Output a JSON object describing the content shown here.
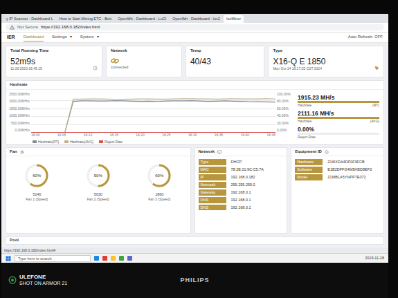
{
  "photo": {
    "watermark_brand": "ULEFONE",
    "watermark_caption": "SHOT ON ARMOR 21",
    "monitor_brand": "PHILIPS"
  },
  "browser": {
    "tabs": [
      {
        "label": "y IP Scanner - Dashboard L",
        "selected": false
      },
      {
        "label": "How to Start Mining ETC - Bett",
        "selected": false
      },
      {
        "label": "OpenWrt - Dashboard - LuCI",
        "selected": false
      },
      {
        "label": "OpenWrt - Dashboard - lux2",
        "selected": false
      },
      {
        "label": "IceMiner",
        "selected": true
      }
    ],
    "security": "Not Secure",
    "url": "https://192.168.0.182/index.html",
    "status_url": "https://192.168.0.182/index.html#"
  },
  "nav": {
    "logo": "IER",
    "items": [
      {
        "label": "Dashboard",
        "selected": true
      },
      {
        "label": "Settings",
        "caret": "▾",
        "selected": false
      },
      {
        "label": "System",
        "caret": "▾",
        "selected": false
      }
    ],
    "auto_refresh": "Auto Refresh: OFF"
  },
  "cards": [
    {
      "title": "Total Running Time",
      "value": "52m9s",
      "sub": "11-28 2023 16:45:15",
      "kind": "clock"
    },
    {
      "title": "Network",
      "value": "connected",
      "kind": "link"
    },
    {
      "title": "Temp",
      "value": "40/43",
      "kind": "plain"
    },
    {
      "title": "Type",
      "value": "X16-Q E 1850",
      "sub": "Mon Oct 14 16:17:25 CST 2024",
      "kind": "tag"
    }
  ],
  "hashrate": {
    "title": "Hashrate",
    "y_max": 2500,
    "y2_max": 100,
    "y_ticks": [
      "2500.00MH/s",
      "2000.00MH/s",
      "1500.00MH/s",
      "1000.00MH/s",
      "500.00MH/s",
      "0.00MH/s"
    ],
    "y2_ticks": [
      "100.00%",
      "80.00%",
      "60.00%",
      "40.00%",
      "20.00%",
      "0.00%"
    ],
    "x_ticks": [
      "16:00",
      "16:05",
      "16:10",
      "16:15",
      "16:20",
      "16:25",
      "16:30",
      "16:35",
      "16:40",
      "16:45"
    ],
    "series": [
      {
        "name": "Hashrate(RT)",
        "axis": "left",
        "color": "#7f8b97",
        "values": [
          0,
          0,
          0,
          0,
          0,
          1960,
          1985,
          1990,
          1975,
          1980,
          1995,
          1985,
          1970,
          1960,
          1965,
          1950,
          1975,
          1990,
          1985,
          1995,
          1980,
          1960,
          1970,
          1985,
          1965,
          1955,
          1940,
          1935,
          1925,
          1915
        ]
      },
      {
        "name": "Hashrate(AVG)",
        "axis": "left",
        "color": "#c2b290",
        "values": [
          0,
          0,
          0,
          0,
          0,
          2095,
          2100,
          2105,
          2110,
          2100,
          2090,
          2085,
          2100,
          2110,
          2105,
          2095,
          2100,
          2110,
          2115,
          2120,
          2110,
          2105,
          2100,
          2110,
          2115,
          2110,
          2105,
          2110,
          2115,
          2111
        ]
      },
      {
        "name": "Reject Rate",
        "axis": "right",
        "color": "#d9534f",
        "values": [
          0,
          0,
          0,
          0,
          0,
          0,
          0,
          0,
          0,
          0,
          0,
          0,
          0,
          0,
          0,
          0,
          0,
          0,
          0,
          0,
          0,
          0,
          0,
          0,
          0,
          0,
          0,
          0,
          0,
          0
        ]
      }
    ],
    "stats": [
      {
        "value": "1915.23 MH/s",
        "label": "Hashrate",
        "tag": "(RT)",
        "level": 1
      },
      {
        "value": "2111.16 MH/s",
        "label": "Hashrate",
        "tag": "(AVG)",
        "level": 1
      },
      {
        "value": "0.00%",
        "label": "Reject Rate",
        "tag": "",
        "level": 0
      }
    ]
  },
  "fans": {
    "title": "Fan",
    "items": [
      {
        "percent": "60%",
        "level": 0.6,
        "rpm": "5140",
        "name": "Fan 1 (Speed)"
      },
      {
        "percent": "50%",
        "level": 0.5,
        "rpm": "5030",
        "name": "Fan 2 (Speed)"
      },
      {
        "percent": "60%",
        "level": 0.6,
        "rpm": "1860",
        "name": "Fan 3 (Speed)"
      }
    ]
  },
  "network": {
    "title": "Network",
    "rows": [
      {
        "label": "Type",
        "value": "DHCP"
      },
      {
        "label": "MAC",
        "value": "78:2E:21:9C:C5:7A"
      },
      {
        "label": "IP",
        "value": "192.168.0.182"
      },
      {
        "label": "Netmask",
        "value": "255.255.255.0"
      },
      {
        "label": "Gateway",
        "value": "192.168.0.1"
      },
      {
        "label": "DNS",
        "value": "192.168.0.1"
      },
      {
        "label": "DNS",
        "value": "192.168.0.1"
      }
    ]
  },
  "equipment": {
    "title": "Equipment ID",
    "rows": [
      {
        "label": "Hardware",
        "value": "Z16IXDA4DP0F9FCB"
      },
      {
        "label": "Software",
        "value": "E1B2DFFG4M5HBD8EF3"
      },
      {
        "label": "Model",
        "value": "Z1MBLA5YNPP7E072"
      }
    ]
  },
  "pool": {
    "title": "Pool"
  },
  "taskbar": {
    "search": "Type here to search",
    "apps": [
      {
        "color": "#1e88e5"
      },
      {
        "color": "#e53935"
      },
      {
        "color": "#fbc02d"
      },
      {
        "color": "#43a047"
      },
      {
        "color": "#5c6bc0"
      }
    ],
    "clock": "2023-11-28"
  }
}
